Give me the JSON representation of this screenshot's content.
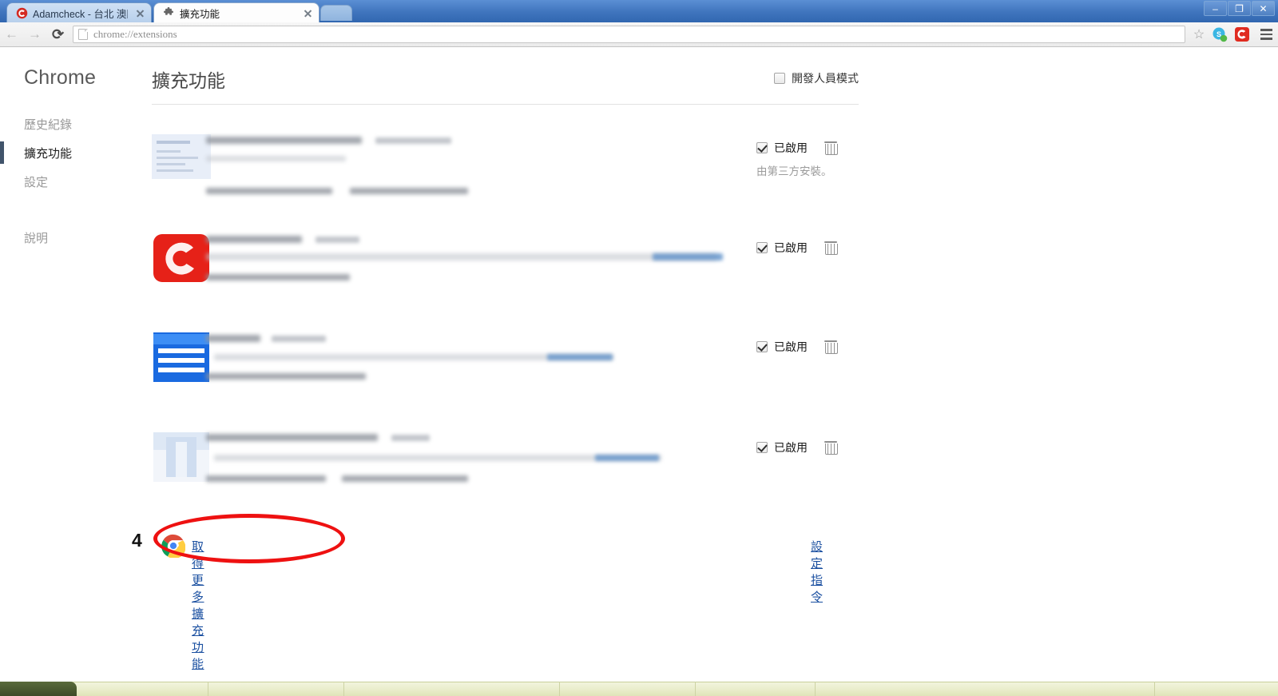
{
  "window": {
    "controls": {
      "minimize": "–",
      "restore": "❐",
      "close": "✕"
    }
  },
  "tabs": [
    {
      "title": "Adamcheck - 台北 澳門 看",
      "favicon": "adamcheck-red-c-icon",
      "active": false
    },
    {
      "title": "擴充功能",
      "favicon": "puzzle-piece-icon",
      "active": true
    }
  ],
  "toolbar": {
    "back": "←",
    "forward": "→",
    "reload": "⟳",
    "url": "chrome://extensions",
    "star": "☆",
    "extension_icons": [
      "skype-icon",
      "adamcheck-red-c-icon"
    ],
    "menu": "hamburger-menu-icon"
  },
  "sidebar": {
    "brand": "Chrome",
    "items": [
      {
        "label": "歷史紀錄",
        "selected": false
      },
      {
        "label": "擴充功能",
        "selected": true
      },
      {
        "label": "設定",
        "selected": false
      },
      {
        "label": "說明",
        "selected": false
      }
    ]
  },
  "main": {
    "title": "擴充功能",
    "developer_mode": {
      "label": "開發人員模式",
      "checked": false
    },
    "enabled_label": "已啟用",
    "third_party_note": "由第三方安裝。",
    "extensions": [
      {
        "icon": "document-white-icon",
        "enabled": true,
        "third_party": true,
        "name_blurred": true
      },
      {
        "icon": "red-rounded-c-icon",
        "enabled": true,
        "third_party": false,
        "name_blurred": true
      },
      {
        "icon": "blue-lines-icon",
        "enabled": true,
        "third_party": false,
        "name_blurred": true
      },
      {
        "icon": "pale-blue-icon",
        "enabled": true,
        "third_party": false,
        "name_blurred": true
      }
    ],
    "store_row": {
      "step_number": "4",
      "icon": "chrome-web-store-icon",
      "link_label": "取得更多擴充功能",
      "commands_link": "設定指令",
      "highlight_color": "#ee1111"
    }
  },
  "colors": {
    "link": "#1a4fa0",
    "tabstrip": "#3f74bd",
    "selected_indicator": "#41546b",
    "annotation": "#ee1111"
  }
}
